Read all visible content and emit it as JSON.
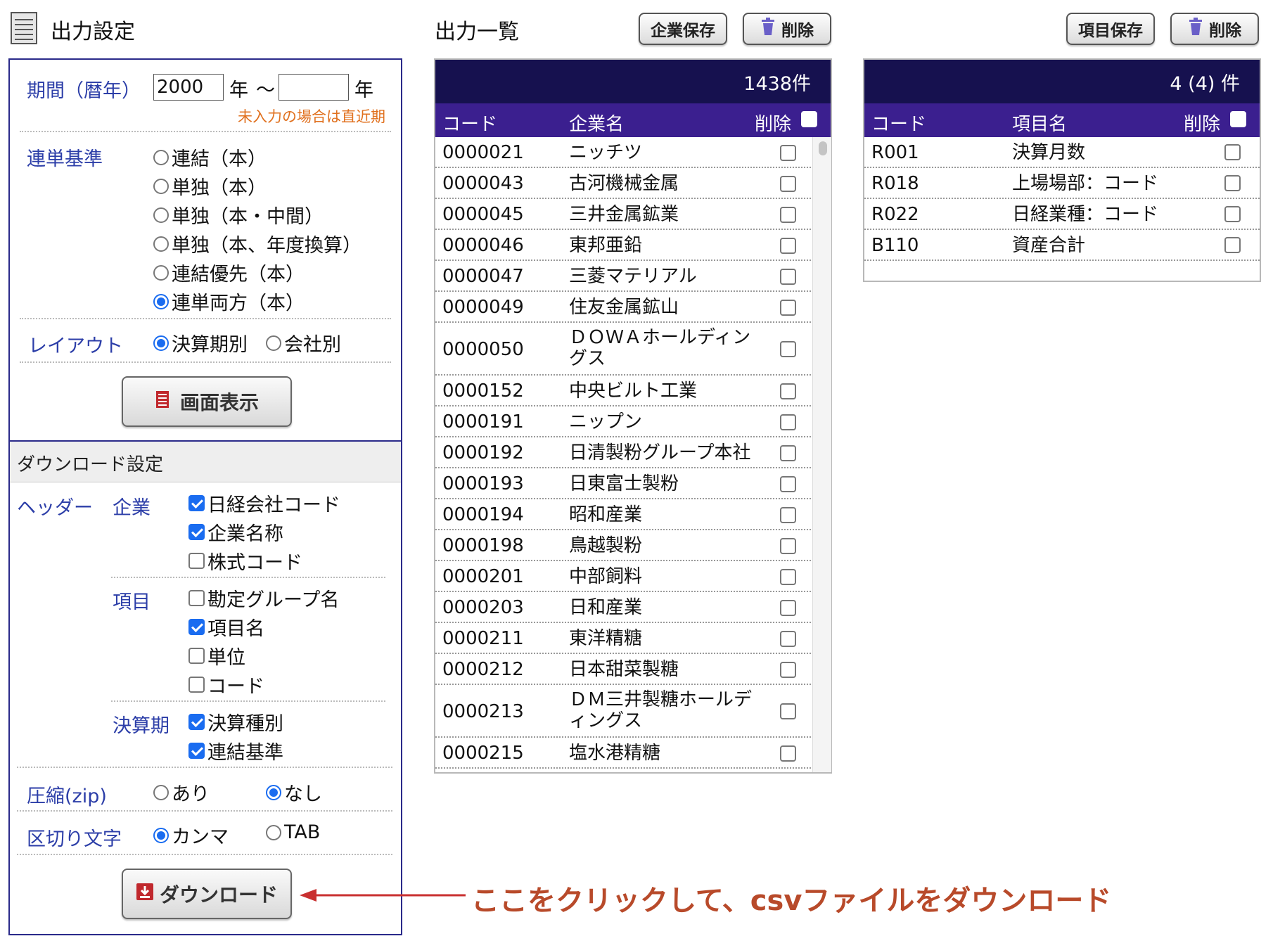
{
  "settings": {
    "title": "出力設定",
    "period": {
      "label": "期間（暦年）",
      "from_value": "2000",
      "year_suffix": "年",
      "tilde": "〜",
      "to_value": "",
      "note": "未入力の場合は直近期"
    },
    "basis": {
      "label": "連単基準",
      "options": [
        "連結（本）",
        "単独（本）",
        "単独（本・中間）",
        "単独（本、年度換算）",
        "連結優先（本）",
        "連単両方（本）"
      ],
      "selected": "連単両方（本）"
    },
    "layout": {
      "label": "レイアウト",
      "options": [
        "決算期別",
        "会社別"
      ],
      "selected": "決算期別"
    },
    "display_button": "画面表示"
  },
  "download": {
    "title": "ダウンロード設定",
    "header_label": "ヘッダー",
    "company": {
      "label": "企業",
      "items": [
        {
          "label": "日経会社コード",
          "checked": true
        },
        {
          "label": "企業名称",
          "checked": true
        },
        {
          "label": "株式コード",
          "checked": false
        }
      ]
    },
    "item": {
      "label": "項目",
      "items": [
        {
          "label": "勘定グループ名",
          "checked": false
        },
        {
          "label": "項目名",
          "checked": true
        },
        {
          "label": "単位",
          "checked": false
        },
        {
          "label": "コード",
          "checked": false
        }
      ]
    },
    "period": {
      "label": "決算期",
      "items": [
        {
          "label": "決算種別",
          "checked": true
        },
        {
          "label": "連結基準",
          "checked": true
        }
      ]
    },
    "zip": {
      "label": "圧縮(zip)",
      "options": [
        "あり",
        "なし"
      ],
      "selected": "なし"
    },
    "delimiter": {
      "label": "区切り文字",
      "options": [
        "カンマ",
        "TAB"
      ],
      "selected": "カンマ"
    },
    "button": "ダウンロード"
  },
  "companies": {
    "title": "出力一覧",
    "save_button": "企業保存",
    "delete_button": "削除",
    "count": "1438件",
    "headers": {
      "code": "コード",
      "name": "企業名",
      "delete": "削除"
    },
    "rows": [
      {
        "code": "0000021",
        "name": "ニッチツ"
      },
      {
        "code": "0000043",
        "name": "古河機械金属"
      },
      {
        "code": "0000045",
        "name": "三井金属鉱業"
      },
      {
        "code": "0000046",
        "name": "東邦亜鉛"
      },
      {
        "code": "0000047",
        "name": "三菱マテリアル"
      },
      {
        "code": "0000049",
        "name": "住友金属鉱山"
      },
      {
        "code": "0000050",
        "name": "ＤＯＷＡホールディン",
        "name2": "グス"
      },
      {
        "code": "0000152",
        "name": "中央ビルト工業"
      },
      {
        "code": "0000191",
        "name": "ニップン"
      },
      {
        "code": "0000192",
        "name": "日清製粉グループ本社"
      },
      {
        "code": "0000193",
        "name": "日東富士製粉"
      },
      {
        "code": "0000194",
        "name": "昭和産業"
      },
      {
        "code": "0000198",
        "name": "鳥越製粉"
      },
      {
        "code": "0000201",
        "name": "中部飼料"
      },
      {
        "code": "0000203",
        "name": "日和産業"
      },
      {
        "code": "0000211",
        "name": "東洋精糖"
      },
      {
        "code": "0000212",
        "name": "日本甜菜製糖"
      },
      {
        "code": "0000213",
        "name": "ＤＭ三井製糖ホールデ",
        "name2": "ィングス"
      },
      {
        "code": "0000215",
        "name": "塩水港精糖"
      }
    ]
  },
  "items": {
    "save_button": "項目保存",
    "delete_button": "削除",
    "count": "4 (4) 件",
    "headers": {
      "code": "コード",
      "name": "項目名",
      "delete": "削除"
    },
    "rows": [
      {
        "code": "R001",
        "name": "決算月数"
      },
      {
        "code": "R018",
        "name": "上場場部：コード"
      },
      {
        "code": "R022",
        "name": "日経業種：コード"
      },
      {
        "code": "B110",
        "name": "資産合計"
      }
    ]
  },
  "annotation": "ここをクリックして、csvファイルをダウンロード",
  "colors": {
    "navy_header": "#16114f",
    "purple_header": "#3b1f8f",
    "label_blue": "#2c3ea8",
    "annotation_red": "#b84a2a",
    "check_blue": "#1a6cf0"
  }
}
